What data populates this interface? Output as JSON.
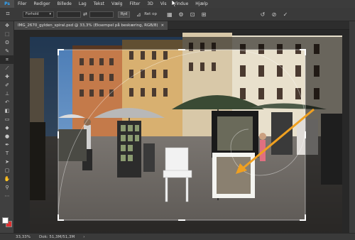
{
  "app": {
    "logo": "Ps"
  },
  "menu": [
    "Filer",
    "Rediger",
    "Billede",
    "Lag",
    "Tekst",
    "Vælg",
    "Filter",
    "3D",
    "Vis",
    "Vindue",
    "Hjælp"
  ],
  "options": {
    "ratio_select": "Forhold",
    "clear_button": "Ryd",
    "straighten_label": "Ret op"
  },
  "document": {
    "tab_title": "IMG_2670_gylden_spiral.psd @ 33,3% (Eksempel på beskæring, RGB/8)"
  },
  "status": {
    "zoom": "33,33%",
    "doc_size": "Dok: 51,3M/51,3M"
  },
  "colors": {
    "accent": "#31a8ff",
    "arrow": "#f0a020",
    "background_swatch": "#e23030"
  }
}
